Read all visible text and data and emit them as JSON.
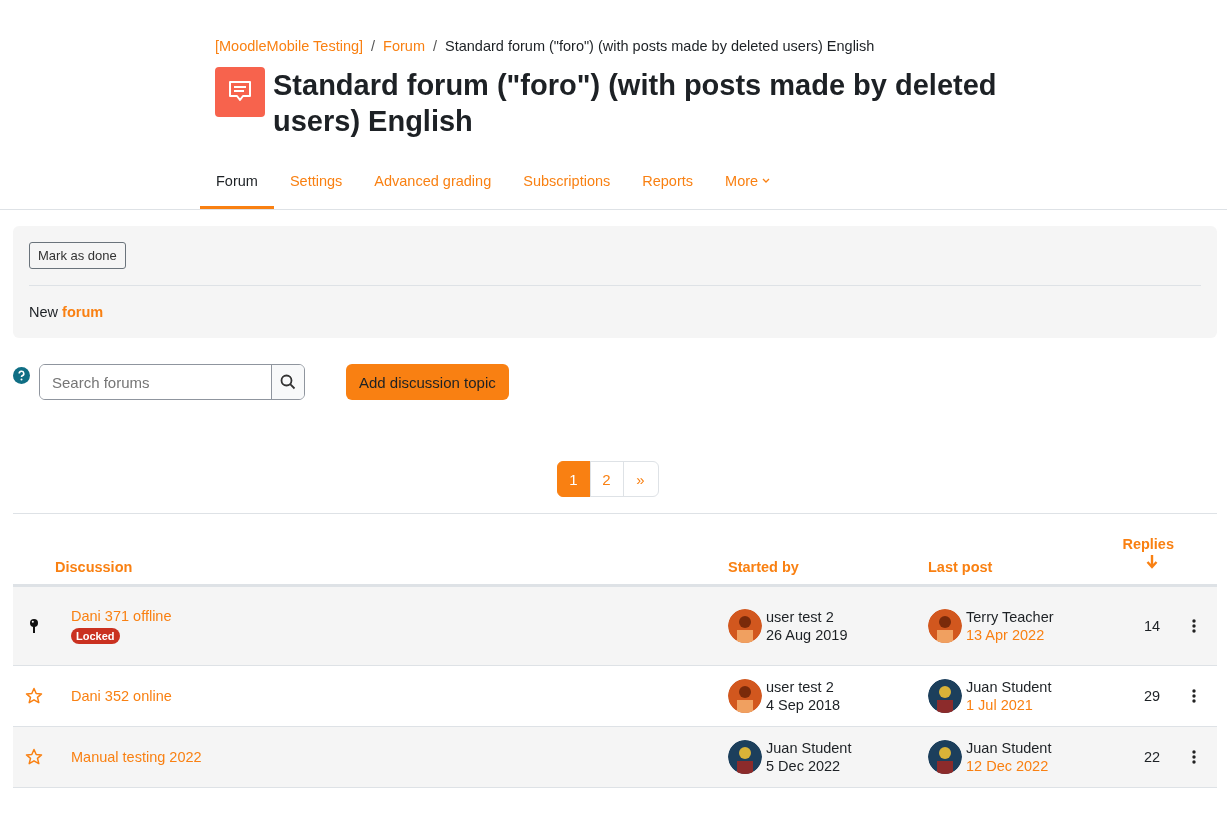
{
  "breadcrumb": [
    {
      "label": "[MoodleMobile Testing]",
      "link": true
    },
    {
      "separator": "/",
      "label": "Forum",
      "link": true
    },
    {
      "separator": "/",
      "label": "Standard forum (\"foro\") (with posts made by deleted users) English",
      "link": false
    }
  ],
  "title": "Standard forum (\"foro\") (with posts made by deleted users) English",
  "tabs": [
    {
      "label": "Forum",
      "selected": true,
      "dropdown": false
    },
    {
      "label": "Settings",
      "selected": false,
      "dropdown": false
    },
    {
      "label": "Advanced grading",
      "selected": false,
      "dropdown": false
    },
    {
      "label": "Subscriptions",
      "selected": false,
      "dropdown": false
    },
    {
      "label": "Reports",
      "selected": false,
      "dropdown": false
    },
    {
      "label": "More",
      "selected": false,
      "dropdown": true
    }
  ],
  "completion": {
    "button": "Mark as done",
    "text_before": "New",
    "link": "forum"
  },
  "search": {
    "placeholder": "Search forums"
  },
  "add_button": "Add discussion topic",
  "pagination": [
    {
      "label": "1",
      "selected": true
    },
    {
      "label": "2",
      "selected": false
    },
    {
      "label": "»",
      "selected": false
    }
  ],
  "table": {
    "columns": [
      "Discussion",
      "Started by",
      "Last post",
      "Replies"
    ],
    "rows": [
      {
        "title": "Dani 371 offline",
        "pinned": true,
        "badge": "Locked",
        "started_by": "user test 2",
        "started_date": "26 Aug 2019",
        "last_by": "Terry Teacher",
        "last_date": "13 Apr 2022",
        "replies": "14"
      },
      {
        "title": "Dani 352 online",
        "pinned": false,
        "started_by": "user test 2",
        "started_date": "4 Sep 2018",
        "last_by": "Juan Student",
        "last_date": "1 Jul 2021",
        "replies": "29"
      },
      {
        "title": "Manual testing 2022",
        "pinned": false,
        "started_by": "Juan Student",
        "started_date": "5 Dec 2022",
        "last_by": "Juan Student",
        "last_date": "12 Dec 2022",
        "replies": "22"
      }
    ]
  }
}
